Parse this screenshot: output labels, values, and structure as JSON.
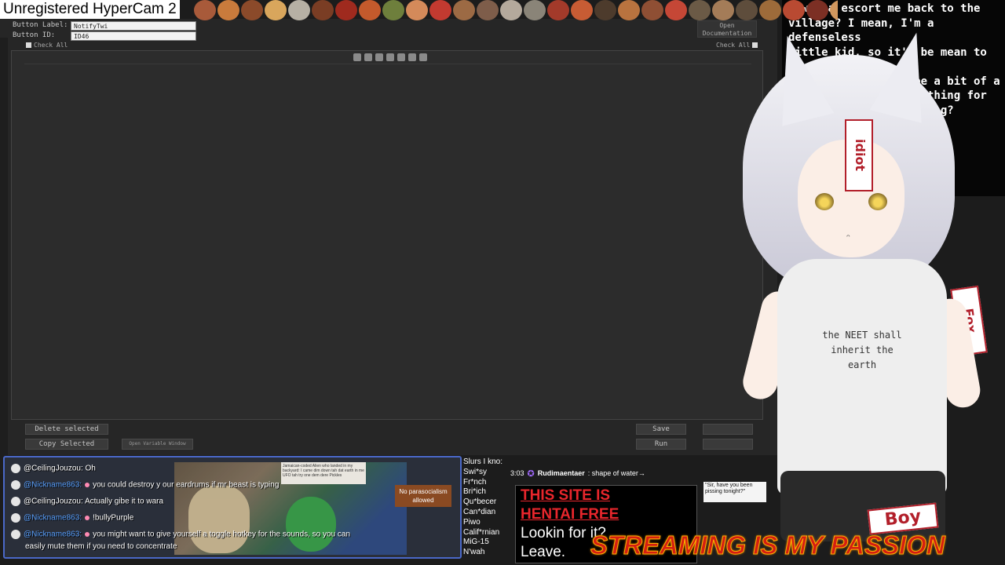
{
  "watermark": "Unregistered HyperCam 2",
  "food_strip": {
    "colors": [
      "#a85a3a",
      "#c97b3c",
      "#8b4a2a",
      "#d9a65c",
      "#b6b0a4",
      "#7a3d24",
      "#9f2a1e",
      "#c45a2c",
      "#6e7f3c",
      "#d48a5a",
      "#c23a30",
      "#9c6a44",
      "#7e5d4a",
      "#b4a99c",
      "#8a8478",
      "#a33a2a",
      "#c75c34",
      "#4d3b2c",
      "#b9733f",
      "#8f4f34",
      "#c54736",
      "#6b5a46",
      "#a47c58",
      "#5e4d3c",
      "#9d6b3a",
      "#b94a32",
      "#7c2f24",
      "#d1975e",
      "#6f6f5e"
    ]
  },
  "editor": {
    "button_label_caption": "Button Label:",
    "button_label_value": "NotifyTwi",
    "button_id_caption": "Button ID:",
    "button_id_value": "ID46",
    "doc_button": "Open\nDocumentation",
    "check_all_left": "Check All",
    "check_all_right": "Check All",
    "delete_selected": "Delete selected",
    "copy_selected": "Copy Selected",
    "open_variable_window": "Open Variable Window",
    "save": "Save",
    "run": "Run"
  },
  "vtuber": {
    "caption": "u wanna escort me back to the\nvillage? I mean, I'm a defenseless\nlittle kid, so it'd be mean to say no!\nThis is getting to be a bit of a\nhabit. Do you have a thing for\nolder women or something?\n        ...self into my\n           ...er you wish.\n              ...er well-done..\n              ...a nice medium-\n\n                  ...to any of\n                  ...to just...",
    "forehead_tag": "idiot",
    "side_tag": "Fox",
    "shirt_text": "the NEET shall\ninherit the\nearth"
  },
  "chat": {
    "messages": [
      {
        "user": "@CeilingJouzou:",
        "text": "Oh"
      },
      {
        "user": "@Nickname863:",
        "text": "you could destroy y our eardrums if mr beast is typing"
      },
      {
        "user": "@CeilingJouzou:",
        "text": "Actually gibe it to wara"
      },
      {
        "user": "@Nickname863:",
        "text": "!bullyPurple"
      },
      {
        "user": "@Nickname863:",
        "text": "you might want to give yourself a toggle hotkey for the sounds, so you can"
      }
    ],
    "continuation": "easily mute them if you need to concentrate",
    "note": "Jamaican-coded Alien who landed in my backyard: I came dim down tah dat earth in me UFO tah try one dem dere Pickles",
    "badge": "No parasocialism\nallowed"
  },
  "slurs": "Slurs I kno:\nSwi*sy\nFr*nch\nBri*ich\nQu*becer\nCan*dian\nPiwo\nCalif*rnian\nMiG-15\nN'wah",
  "alert": {
    "time": "3:03",
    "name": "Rudimaentaer",
    "text": ": shape of water→"
  },
  "ad": {
    "line1": "THIS SITE IS",
    "line2": "HENTAI FREE",
    "line3": "Lookin for it?",
    "line4": "Leave."
  },
  "quote": "\"Sir, have you been\npissing tonight?\"",
  "boy_tag": "Boy",
  "passion": "STREAMING IS MY PASSION"
}
